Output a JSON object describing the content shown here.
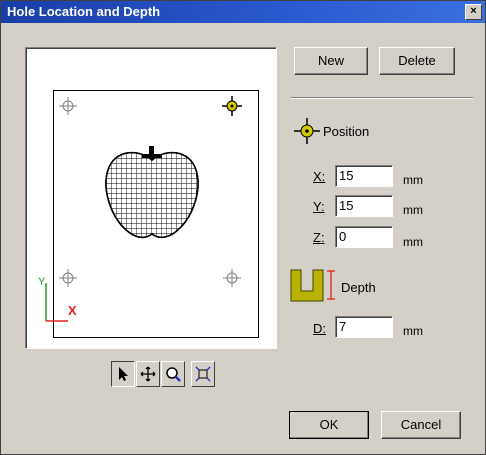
{
  "window": {
    "title": "Hole Location and Depth",
    "close_glyph": "×"
  },
  "buttons": {
    "new": "New",
    "delete": "Delete",
    "ok": "OK",
    "cancel": "Cancel"
  },
  "position": {
    "label": "Position",
    "x_label": "X:",
    "y_label": "Y:",
    "z_label": "Z:",
    "x_value": "15",
    "y_value": "15",
    "z_value": "0",
    "unit": "mm"
  },
  "depth": {
    "label": "Depth",
    "d_label": "D:",
    "d_value": "7",
    "unit": "mm"
  },
  "preview": {
    "axis_x": "X",
    "axis_y": "Y"
  },
  "toolbar": {
    "tools": [
      "select-arrow-icon",
      "pan-move-icon",
      "zoom-icon",
      "fit-view-icon"
    ]
  },
  "colors": {
    "marker_yellow": "#d4c800",
    "depth_icon": "#b8b400",
    "axis_x": "#e02020",
    "axis_y": "#20a020",
    "title_blue": "#1a3ea8"
  }
}
